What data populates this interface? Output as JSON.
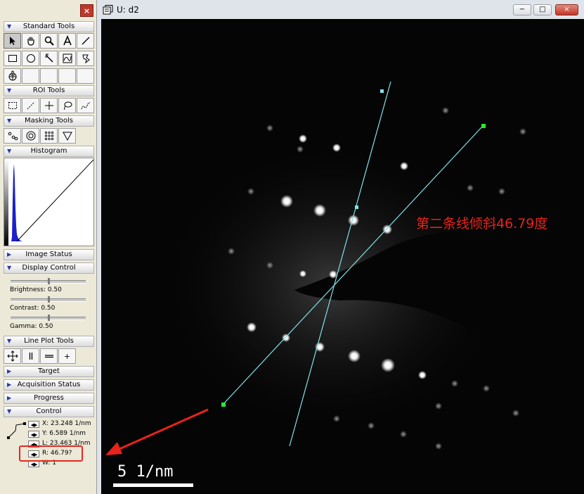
{
  "panel": {
    "close_label": "×",
    "sections": {
      "standard_tools": "Standard Tools",
      "roi_tools": "ROI Tools",
      "masking_tools": "Masking Tools",
      "histogram": "Histogram",
      "image_status": "Image Status",
      "display_control": "Display Control",
      "line_plot_tools": "Line Plot Tools",
      "target": "Target",
      "acquisition_status": "Acquisition Status",
      "progress": "Progress",
      "control": "Control"
    },
    "display": {
      "brightness": "Brightness: 0.50",
      "contrast": "Contrast: 0.50",
      "gamma": "Gamma: 0.50"
    },
    "line_plot_plus": "+",
    "control": {
      "x": "X: 23.248 1/nm",
      "y": "Y: 6.589 1/nm",
      "l": "L: 23.463 1/nm",
      "r": "R: 46.79?",
      "w": "W: 1"
    }
  },
  "window": {
    "title": "U: d2",
    "min_label": "−",
    "max_label": "□",
    "close_label": "×"
  },
  "image": {
    "scale_label": "5  1/nm",
    "annotation": "第二条线倾斜46.79度"
  },
  "colors": {
    "annotation": "#e8231b",
    "measure_line": "#7fe3ea",
    "endpoint": "#2ee82e",
    "highlight_box": "#e8281e"
  }
}
